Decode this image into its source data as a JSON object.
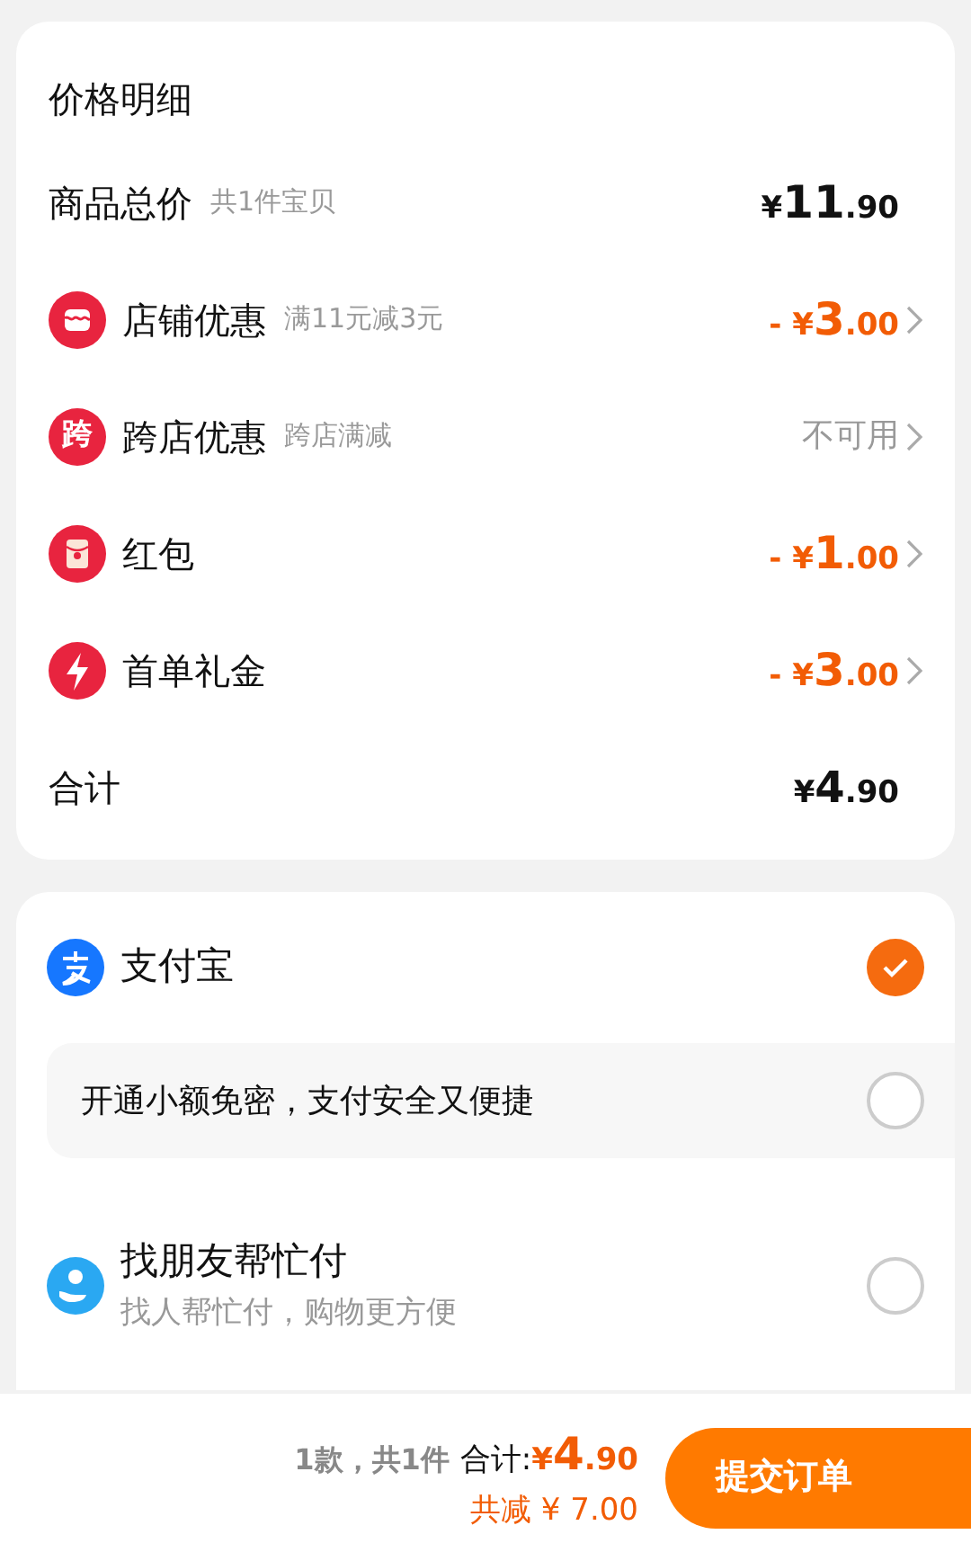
{
  "price_detail": {
    "title": "价格明细",
    "rows": [
      {
        "kind": "subtotal",
        "label": "商品总价",
        "note": "共1件宝贝",
        "value": {
          "prefix": "¥",
          "integer": "11",
          "decimal": ".90"
        }
      },
      {
        "kind": "discount",
        "label": "店铺优惠",
        "note": "满11元减3元",
        "value": {
          "prefix": "- ¥",
          "integer": "3",
          "decimal": ".00"
        }
      },
      {
        "kind": "discount",
        "label": "跨店优惠",
        "icon_text": "跨",
        "note": "跨店满减",
        "status": "不可用"
      },
      {
        "kind": "discount",
        "label": "红包",
        "value": {
          "prefix": "- ¥",
          "integer": "1",
          "decimal": ".00"
        }
      },
      {
        "kind": "discount",
        "label": "首单礼金",
        "value": {
          "prefix": "- ¥",
          "integer": "3",
          "decimal": ".00"
        }
      },
      {
        "kind": "total",
        "label": "合计",
        "value": {
          "prefix": "¥",
          "integer": "4",
          "decimal": ".90"
        }
      }
    ]
  },
  "payment": {
    "methods": [
      {
        "kind": "main",
        "label": "支付宝",
        "selected": true
      },
      {
        "kind": "option",
        "label": "开通小额免密，支付安全又便捷",
        "selected": false
      },
      {
        "kind": "friend",
        "label": "找朋友帮忙付",
        "subtitle": "找人帮忙付，购物更方便",
        "selected": false
      }
    ]
  },
  "footer": {
    "count": "1款，共1件",
    "total_label": "合计:",
    "total": {
      "prefix": "¥",
      "integer": "4",
      "decimal": ".90"
    },
    "saved": "共减 ¥ 7.00",
    "submit": "提交订单"
  }
}
